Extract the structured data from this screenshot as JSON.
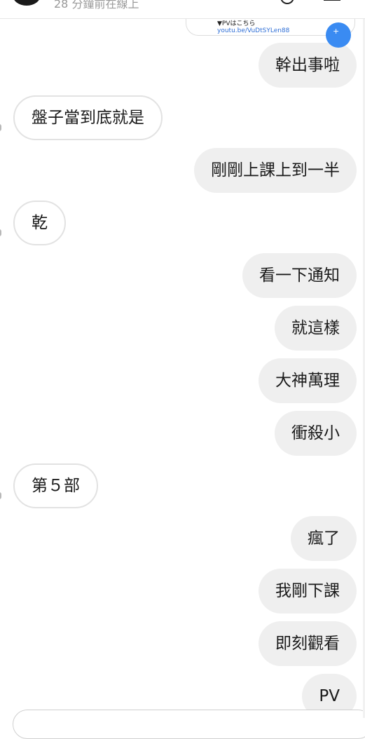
{
  "header": {
    "status_text": "28 分鐘前在線上"
  },
  "link_preview": {
    "pv_text": "▼PVはこちら",
    "url": "youtu.be/VuDtSYLen88",
    "action_icon_text": "+"
  },
  "messages": [
    {
      "side": "out",
      "text": "幹出事啦"
    },
    {
      "side": "in",
      "text": "盤子當到底就是"
    },
    {
      "side": "out",
      "text": "剛剛上課上到一半"
    },
    {
      "side": "in",
      "text": "乾"
    },
    {
      "side": "out",
      "text": "看一下通知"
    },
    {
      "side": "out",
      "text": "就這樣"
    },
    {
      "side": "out",
      "text": "大神萬理"
    },
    {
      "side": "out",
      "text": "衝殺小"
    },
    {
      "side": "in",
      "text": "第５部"
    },
    {
      "side": "out",
      "text": "瘋了"
    },
    {
      "side": "out",
      "text": "我剛下課"
    },
    {
      "side": "out",
      "text": "即刻觀看"
    },
    {
      "side": "out",
      "text": "PV"
    }
  ],
  "colors": {
    "outgoing_bubble": "#efefef",
    "incoming_border": "#e2e2e2",
    "link": "#2f6fd6",
    "status_text": "#9a9a9a"
  }
}
